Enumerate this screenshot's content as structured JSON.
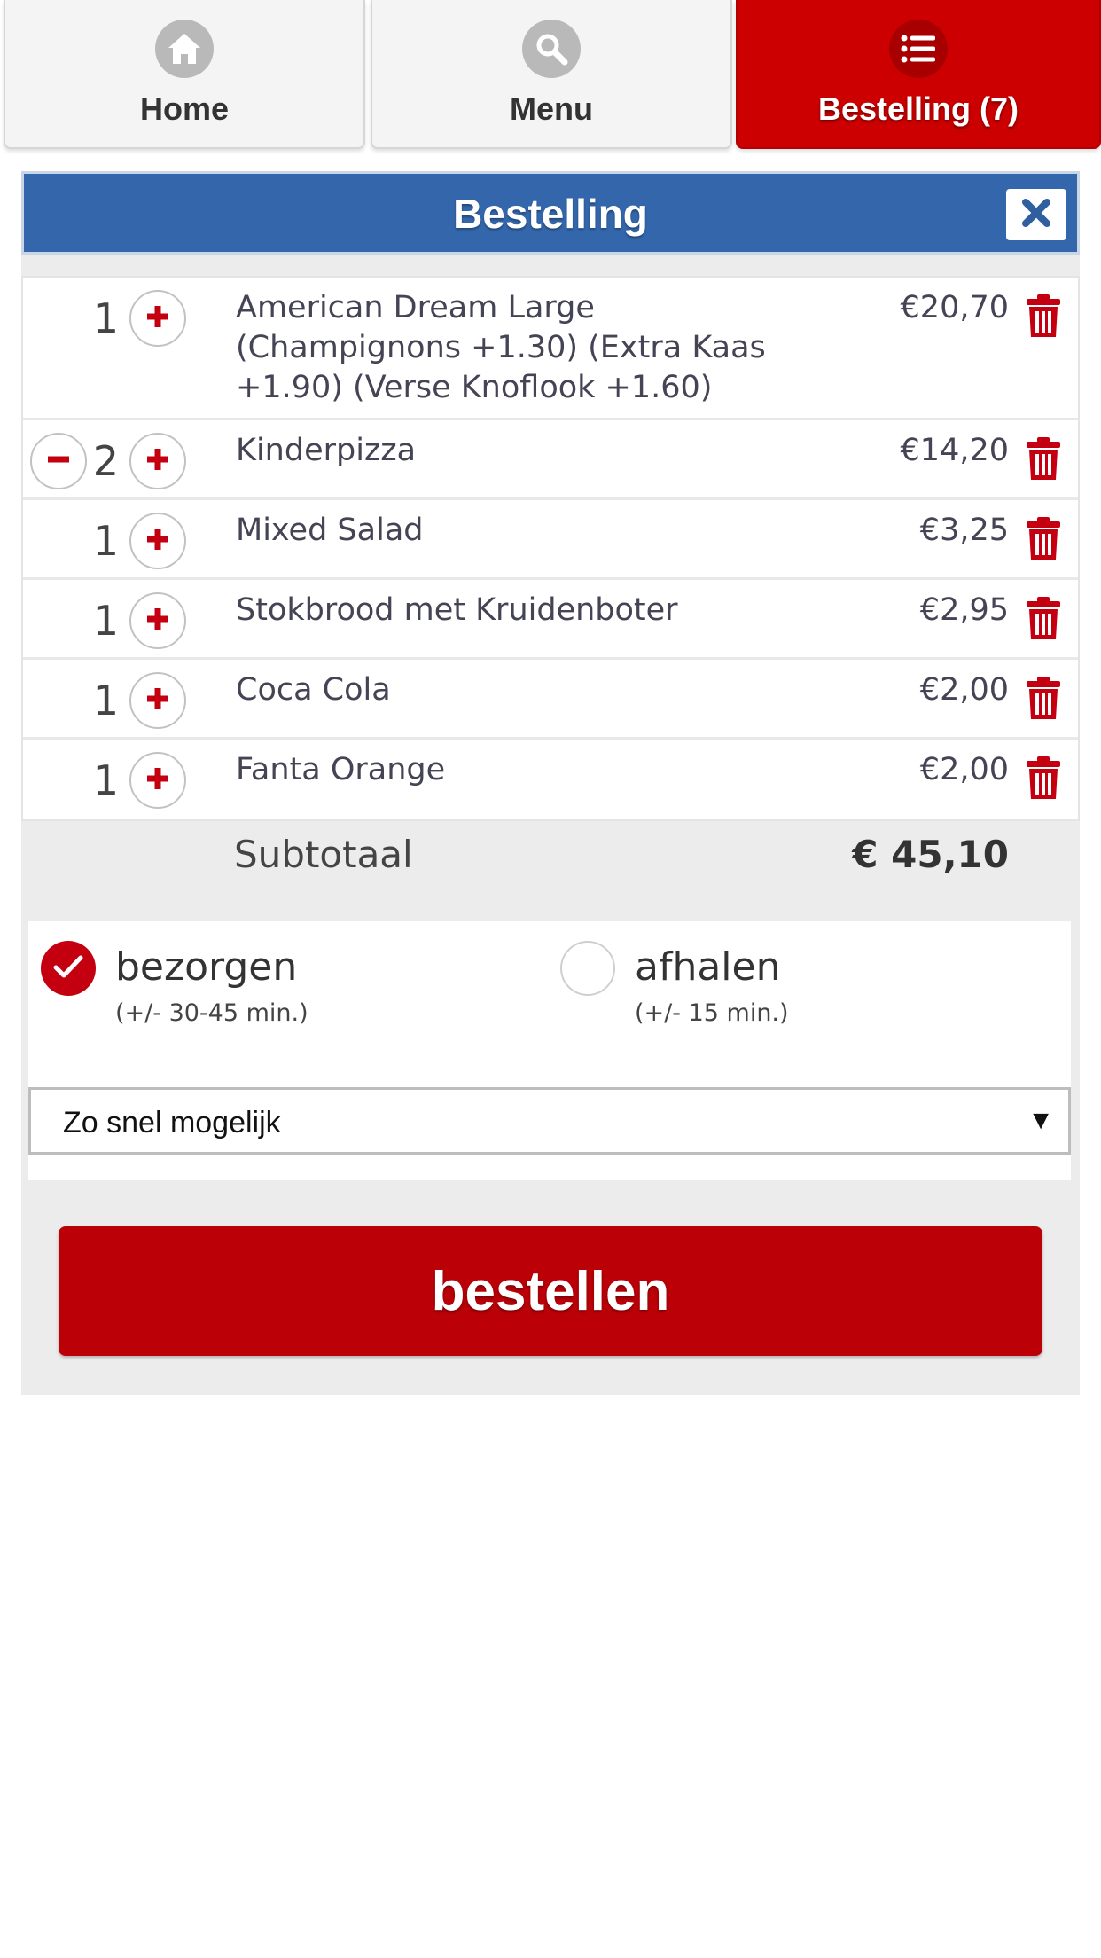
{
  "tabs": [
    {
      "label": "Home",
      "icon": "home-icon",
      "active": false
    },
    {
      "label": "Menu",
      "icon": "search-icon",
      "active": false
    },
    {
      "label": "Bestelling (7)",
      "icon": "list-icon",
      "active": true
    }
  ],
  "panel": {
    "title": "Bestelling",
    "close_icon": "close-icon"
  },
  "items": [
    {
      "qty": "1",
      "name": "American Dream Large (Champignons +1.30) (Extra Kaas +1.90) (Verse Knoflook +1.60)",
      "price": "€20,70"
    },
    {
      "qty": "2",
      "name": "Kinderpizza",
      "price": "€14,20"
    },
    {
      "qty": "1",
      "name": "Mixed Salad",
      "price": "€3,25"
    },
    {
      "qty": "1",
      "name": "Stokbrood met Kruidenboter",
      "price": "€2,95"
    },
    {
      "qty": "1",
      "name": "Coca Cola",
      "price": "€2,00"
    },
    {
      "qty": "1",
      "name": "Fanta Orange",
      "price": "€2,00"
    }
  ],
  "subtotal": {
    "label": "Subtotaal",
    "value": "€ 45,10"
  },
  "delivery": {
    "options": [
      {
        "label": "bezorgen",
        "sub": "(+/- 30-45 min.)",
        "selected": true
      },
      {
        "label": "afhalen",
        "sub": "(+/- 15 min.)",
        "selected": false
      }
    ],
    "time_select": {
      "value": "Zo snel mogelijk",
      "arrow": "▼"
    }
  },
  "order_button": {
    "label": "bestellen"
  },
  "colors": {
    "brand_red": "#cc0000",
    "header_blue": "#3366aa",
    "button_red": "#bb0008"
  }
}
